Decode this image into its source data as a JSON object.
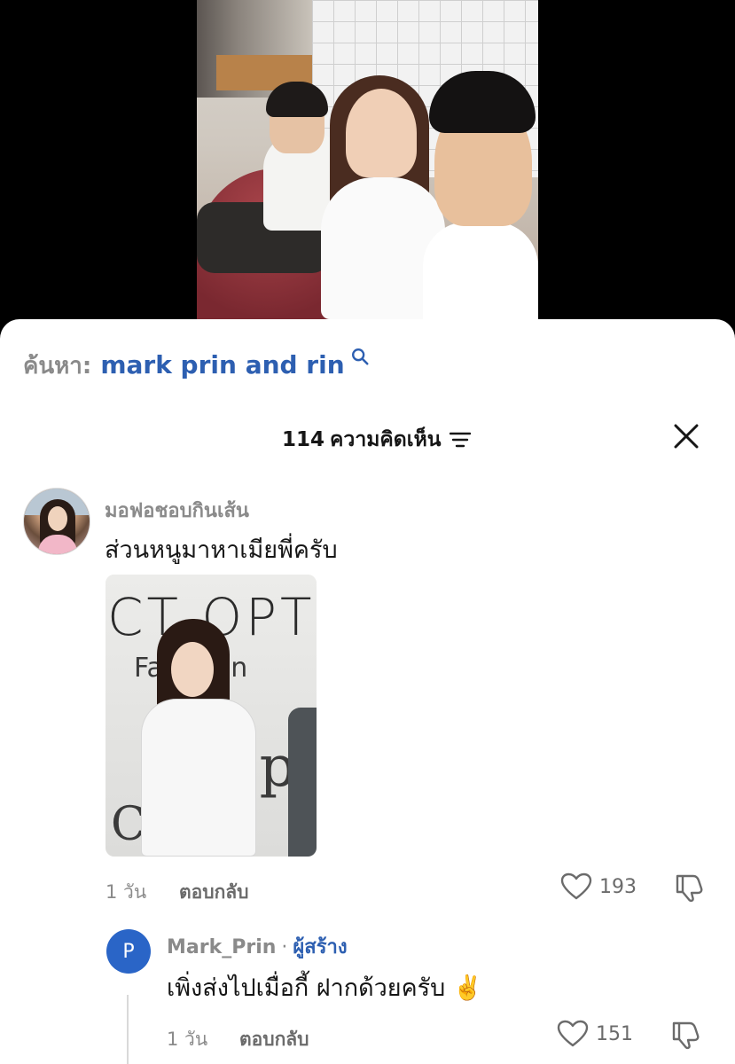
{
  "search": {
    "label": "ค้นหา:",
    "query": "mark prin and rin"
  },
  "comments_header": {
    "count": "114",
    "label": "ความคิดเห็น"
  },
  "comment": {
    "username": "มอฟอชอบกินเส้น",
    "text": "ส่วนหนูมาหาเมียพี่ครับ",
    "attachment_text": [
      "CT OPT",
      "Fas  Islan",
      "n   p",
      "C     t"
    ],
    "time": "1 วัน",
    "reply_label": "ตอบกลับ",
    "likes": "193"
  },
  "reply": {
    "avatar_letter": "P",
    "username": "Mark_Prin",
    "separator": "·",
    "creator_badge": "ผู้สร้าง",
    "text": "เพิ่งส่งไปเมื่อกี้ ฝากด้วยครับ ✌️",
    "time": "1 วัน",
    "reply_label": "ตอบกลับ",
    "likes": "151"
  },
  "colors": {
    "accent_blue": "#2d5fb1",
    "avatar_blue": "#2a65c7",
    "muted_text": "#8a8a8a"
  },
  "icons": [
    "search-icon",
    "filter-icon",
    "close-icon",
    "heart-icon",
    "dislike-icon"
  ]
}
